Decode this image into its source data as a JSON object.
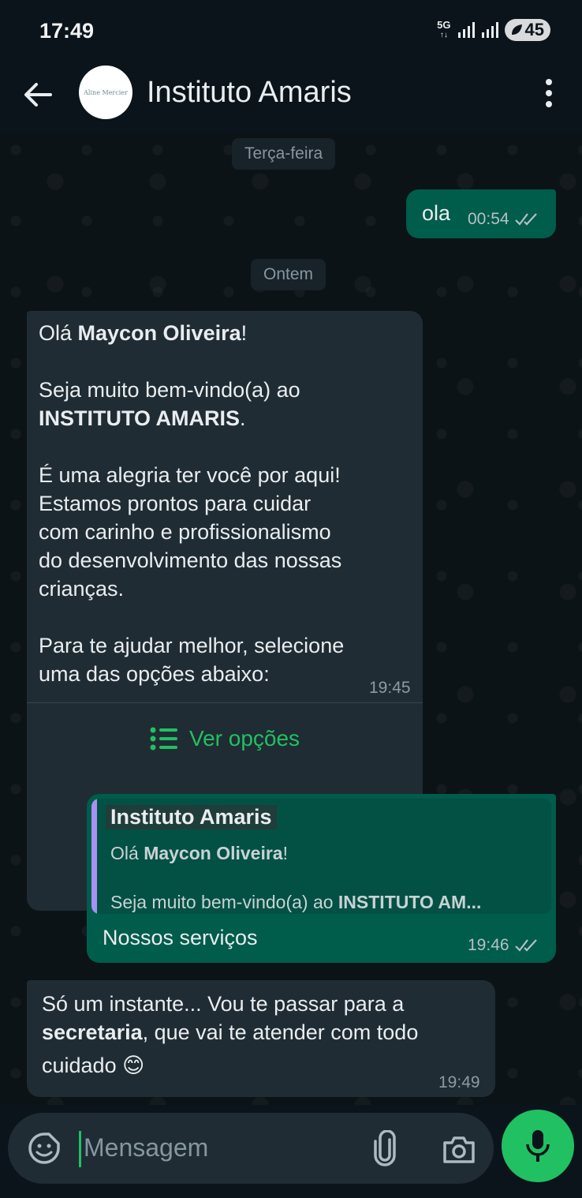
{
  "status_bar": {
    "time": "17:49",
    "network": "5G",
    "battery": "45"
  },
  "header": {
    "avatar_text": "Aline Mercier",
    "title": "Instituto Amaris"
  },
  "dates": {
    "first": "Terça-feira",
    "second": "Ontem"
  },
  "messages": {
    "m1": {
      "text": "ola",
      "time": "00:54"
    },
    "m2": {
      "greeting_pre": "Olá ",
      "greeting_name": "Maycon Oliveira",
      "greeting_post": "!",
      "welcome_pre": "Seja muito bem-vindo(a) ao",
      "welcome_org": "INSTITUTO AMARIS",
      "welcome_post": ".",
      "p3_l1": "É uma alegria ter você por aqui!",
      "p3_l2": "Estamos prontos para cuidar",
      "p3_l3": "com carinho e profissionalismo",
      "p3_l4": "do desenvolvimento das nossas",
      "p3_l5": "crianças.",
      "p4_l1": "Para te ajudar melhor, selecione",
      "p4_l2": "uma das opções abaixo:",
      "time": "19:45",
      "options_label": "Ver opções"
    },
    "m3": {
      "quote_author": "Instituto Amaris",
      "quote_l1_pre": "Olá ",
      "quote_l1_name": "Maycon Oliveira",
      "quote_l1_post": "!",
      "quote_l2_pre": "Seja muito bem-vindo(a) ao ",
      "quote_l2_bold": "INSTITUTO AM...",
      "text": "Nossos serviços",
      "time": "19:46"
    },
    "m4": {
      "l1": "Só um instante... Vou te passar para a",
      "l2_bold": "secretaria",
      "l2_rest": ", que vai te atender com todo",
      "l3": "cuidado ",
      "emoji": "😊",
      "time": "19:49"
    }
  },
  "input": {
    "placeholder": "Mensagem"
  },
  "colors": {
    "accent": "#21c063",
    "outgoing": "#005c4b",
    "incoming": "#202c33",
    "background": "#0b141a"
  }
}
